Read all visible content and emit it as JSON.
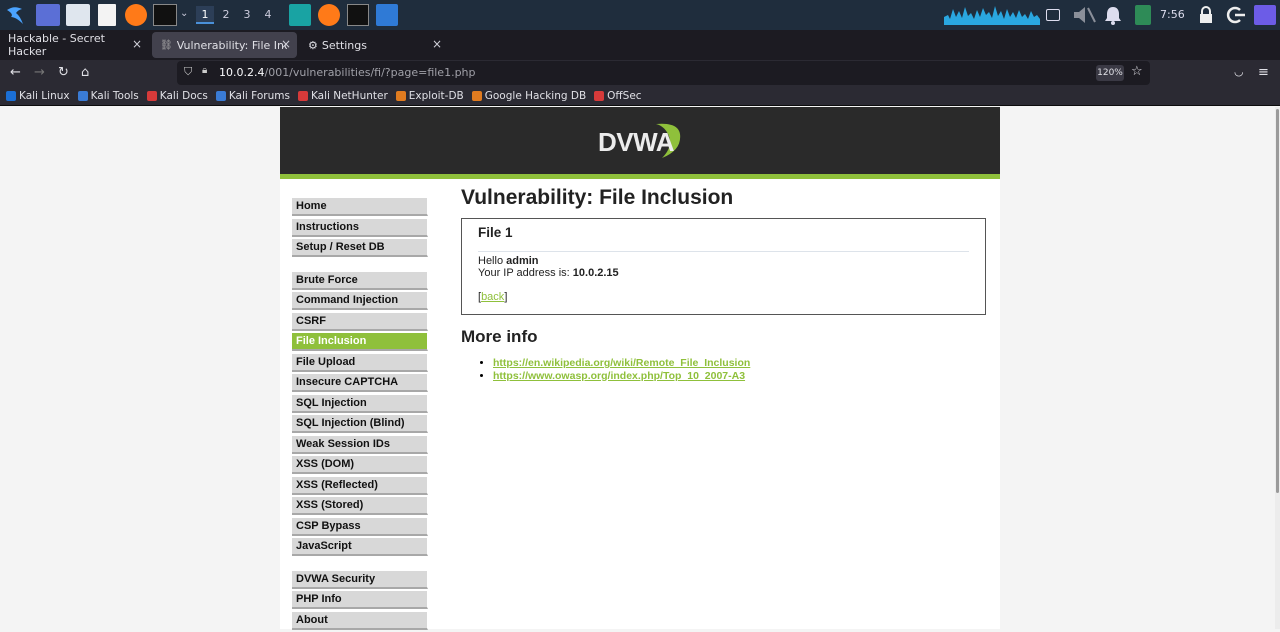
{
  "taskbar": {
    "workspaces": [
      "1",
      "2",
      "3",
      "4"
    ],
    "clock": "7:56"
  },
  "tabs": [
    {
      "title": "Hackable - Secret Hacker",
      "close": "×"
    },
    {
      "title": "Vulnerability: File Inclusio",
      "close": "×"
    },
    {
      "title": "Settings",
      "close": "×"
    }
  ],
  "new_tab": "+",
  "nav": {
    "url_host": "10.0.2.4",
    "url_path": "/001/vulnerabilities/fi/?page=file1.php",
    "zoom": "120%"
  },
  "bookmarks": [
    {
      "label": "Kali Linux",
      "color": "#1b6fd6"
    },
    {
      "label": "Kali Tools",
      "color": "#3a7bd5"
    },
    {
      "label": "Kali Docs",
      "color": "#d63a3a"
    },
    {
      "label": "Kali Forums",
      "color": "#3a7bd5"
    },
    {
      "label": "Kali NetHunter",
      "color": "#d63a3a"
    },
    {
      "label": "Exploit-DB",
      "color": "#e07b20"
    },
    {
      "label": "Google Hacking DB",
      "color": "#e07b20"
    },
    {
      "label": "OffSec",
      "color": "#d63a3a"
    }
  ],
  "dvwa": {
    "logo_text": "DVWA",
    "menu_groups": [
      [
        "Home",
        "Instructions",
        "Setup / Reset DB"
      ],
      [
        "Brute Force",
        "Command Injection",
        "CSRF",
        "File Inclusion",
        "File Upload",
        "Insecure CAPTCHA",
        "SQL Injection",
        "SQL Injection (Blind)",
        "Weak Session IDs",
        "XSS (DOM)",
        "XSS (Reflected)",
        "XSS (Stored)",
        "CSP Bypass",
        "JavaScript"
      ],
      [
        "DVWA Security",
        "PHP Info",
        "About"
      ]
    ],
    "selected_menu": "File Inclusion",
    "page_title": "Vulnerability: File Inclusion",
    "file_title": "File 1",
    "hello_prefix": "Hello ",
    "hello_user": "admin",
    "ip_prefix": "Your IP address is: ",
    "ip_value": "10.0.2.15",
    "back_open": "[",
    "back_label": "back",
    "back_close": "]",
    "more_info_title": "More info",
    "links": [
      "https://en.wikipedia.org/wiki/Remote_File_Inclusion",
      "https://www.owasp.org/index.php/Top_10_2007-A3"
    ]
  },
  "colors": {
    "accent": "#8fc03b",
    "header_bg": "#2a2a2a"
  }
}
